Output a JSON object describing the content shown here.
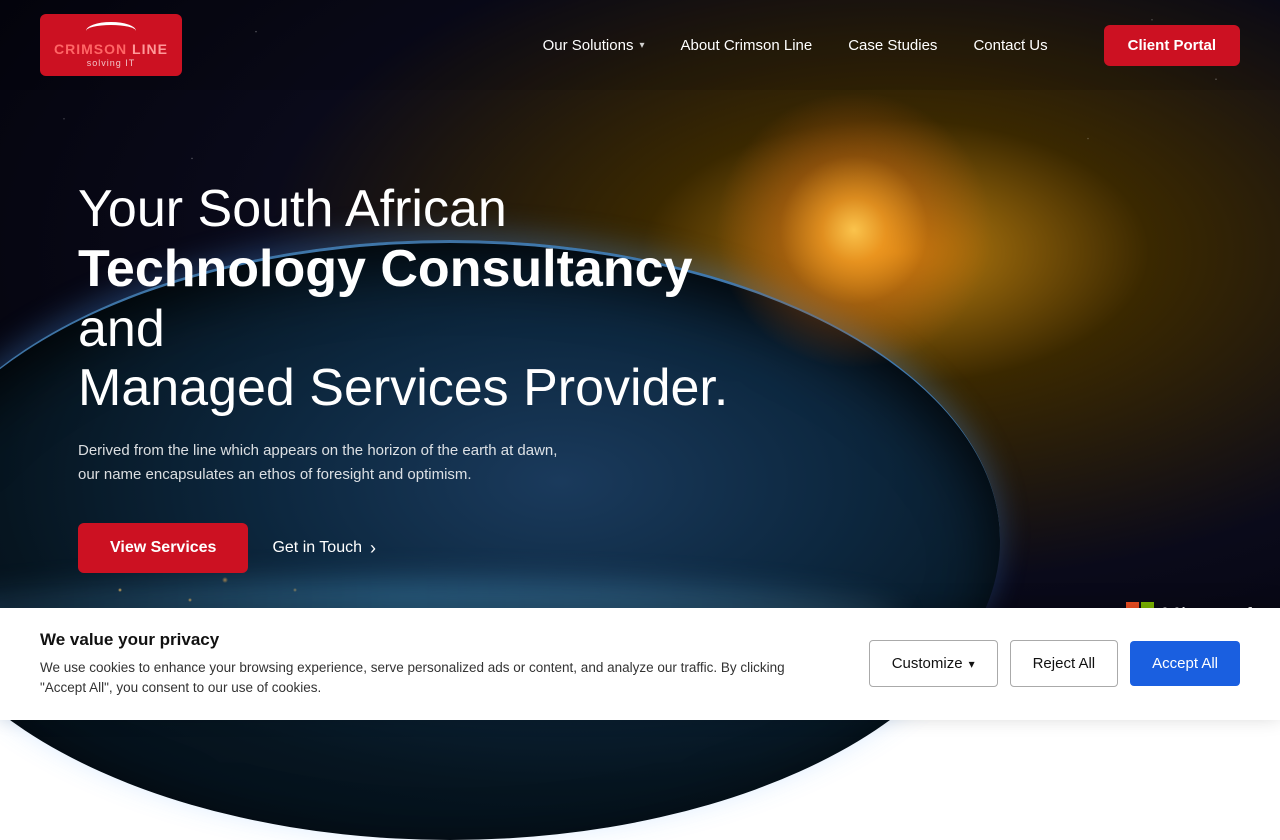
{
  "brand": {
    "name_line1": "CRIMSON",
    "name_line2": "LINE",
    "tagline": "solving IT"
  },
  "nav": {
    "items": [
      {
        "label": "Our Solutions",
        "has_dropdown": true
      },
      {
        "label": "About Crimson Line",
        "has_dropdown": false
      },
      {
        "label": "Case Studies",
        "has_dropdown": false
      },
      {
        "label": "Contact Us",
        "has_dropdown": false
      }
    ],
    "client_portal_label": "Client Portal"
  },
  "hero": {
    "title_line1": "Your South African",
    "title_bold": "Technology Consultancy",
    "title_line3": " and",
    "title_line4": "Managed Services Provider.",
    "subtitle": "Derived from the line which appears on the horizon of the earth at dawn, our name encapsulates an ethos of foresight and optimism.",
    "btn_view_services": "View Services",
    "btn_get_in_touch": "Get in Touch"
  },
  "microsoft_partial": {
    "text": "Microsoft"
  },
  "cookie": {
    "title": "We value your privacy",
    "body": "We use cookies to enhance your browsing experience, serve personalized ads or content, and analyze our traffic. By clicking \"Accept All\", you consent to our use of cookies.",
    "btn_customize": "Customize",
    "btn_reject_all": "Reject All",
    "btn_accept_all": "Accept All"
  }
}
